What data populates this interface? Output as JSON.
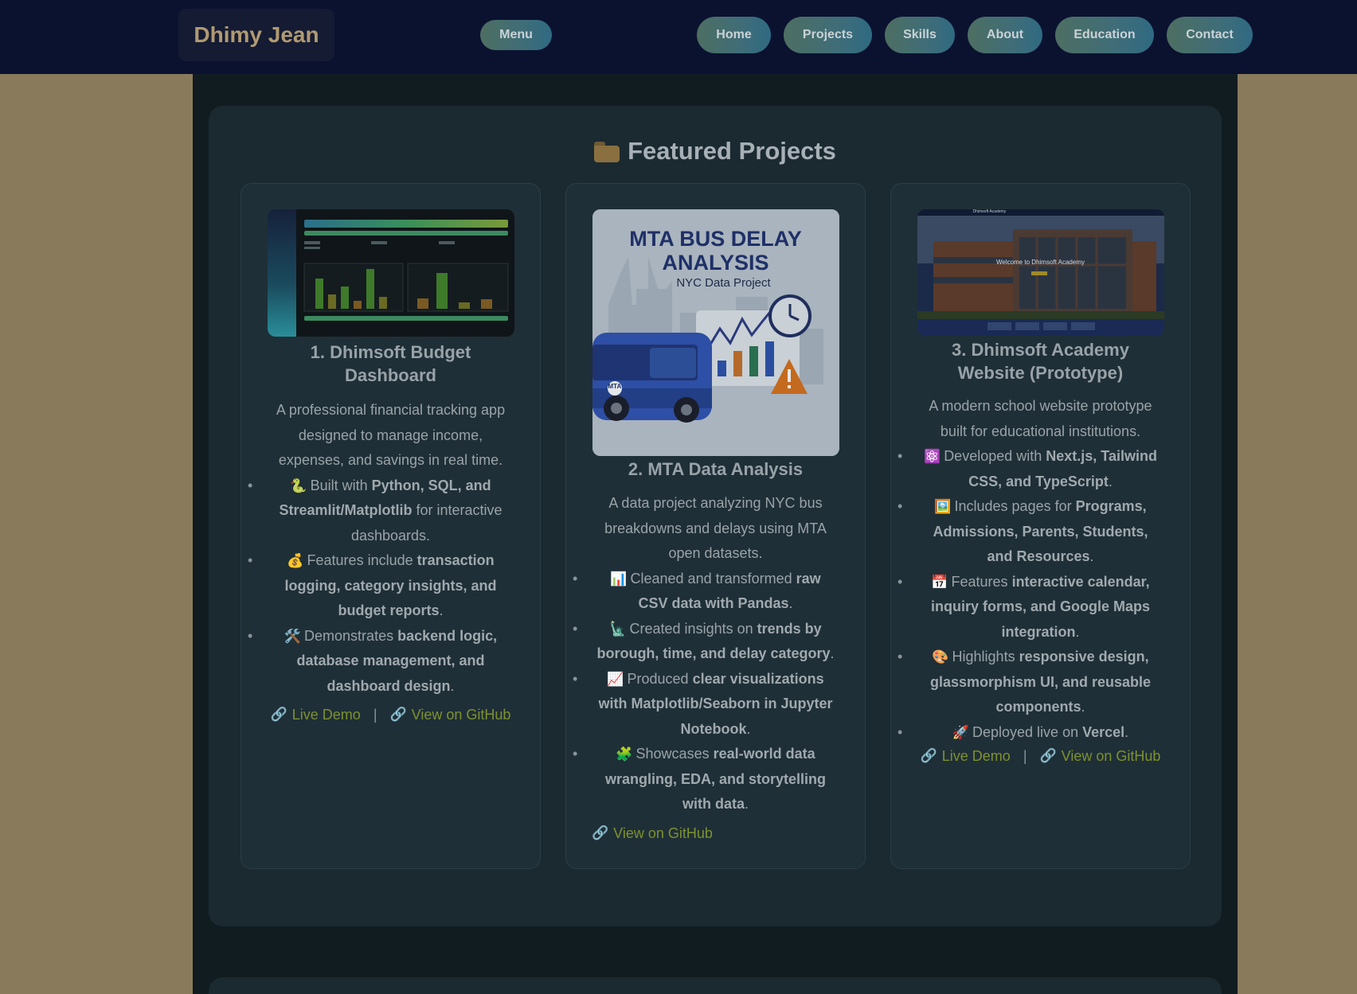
{
  "brand": "Dhimy Jean",
  "nav": {
    "menu_label": "Menu",
    "items": [
      "Home",
      "Projects",
      "Skills",
      "About",
      "Education",
      "Contact"
    ]
  },
  "section": {
    "title": "Featured Projects",
    "title_icon": "folder-icon"
  },
  "projects": [
    {
      "title": "1. Dhimsoft Budget Dashboard",
      "thumb_title": "Dhimsoft Budget Dashboard",
      "description": "A professional financial tracking app designed to manage income, expenses, and savings in real time.",
      "features": [
        {
          "emoji": "🐍",
          "pre": "Built with ",
          "strong": "Python, SQL, and Streamlit/Matplotlib",
          "post": " for interactive dashboards."
        },
        {
          "emoji": "💰",
          "pre": "Features include ",
          "strong": "transaction logging, category insights, and budget reports",
          "post": "."
        },
        {
          "emoji": "🛠️",
          "pre": "Demonstrates ",
          "strong": "backend logic, database management, and dashboard design",
          "post": "."
        }
      ],
      "links": [
        "Live Demo",
        "View on GitHub"
      ],
      "separator": "|"
    },
    {
      "title": "2. MTA Data Analysis",
      "thumb_title_line1": "MTA BUS DELAY",
      "thumb_title_line2": "ANALYSIS",
      "thumb_subtitle": "NYC Data Project",
      "thumb_bus_logo": "MTA",
      "description": "A data project analyzing NYC bus breakdowns and delays using MTA open datasets.",
      "features": [
        {
          "emoji": "📊",
          "pre": "Cleaned and transformed ",
          "strong": "raw CSV data with Pandas",
          "post": "."
        },
        {
          "emoji": "🗽",
          "pre": "Created insights on ",
          "strong": "trends by borough, time, and delay category",
          "post": "."
        },
        {
          "emoji": "📈",
          "pre": "Produced ",
          "strong": "clear visualizations with Matplotlib/Seaborn in Jupyter Notebook",
          "post": "."
        },
        {
          "emoji": "🧩",
          "pre": "Showcases ",
          "strong": "real-world data wrangling, EDA, and storytelling with data",
          "post": "."
        }
      ],
      "links": [
        "View on GitHub"
      ]
    },
    {
      "title": "3. Dhimsoft Academy Website (Prototype)",
      "thumb_header": "Dhimsoft Academy",
      "thumb_welcome": "Welcome to Dhimsoft Academy",
      "description": "A modern school website prototype built for educational institutions.",
      "features": [
        {
          "emoji": "⚛️",
          "pre": "Developed with ",
          "strong": "Next.js, Tailwind CSS, and TypeScript",
          "post": "."
        },
        {
          "emoji": "🖼️",
          "pre": "Includes pages for ",
          "strong": "Programs, Admissions, Parents, Students, and Resources",
          "post": "."
        },
        {
          "emoji": "📅",
          "pre": "Features ",
          "strong": "interactive calendar, inquiry forms, and Google Maps integration",
          "post": "."
        },
        {
          "emoji": "🎨",
          "pre": "Highlights ",
          "strong": "responsive design, glassmorphism UI, and reusable components",
          "post": "."
        },
        {
          "emoji": "🚀",
          "pre": "Deployed live on ",
          "strong": "Vercel",
          "post": "."
        }
      ],
      "links": [
        "Live Demo",
        "View on GitHub"
      ],
      "separator": "|"
    }
  ],
  "colors": {
    "page_bg": "#8a7a5c",
    "navbar_bg": "#0b1230",
    "brand_text": "#b09a72",
    "link": "#7d9130",
    "card_bg": "#1f2f37"
  }
}
